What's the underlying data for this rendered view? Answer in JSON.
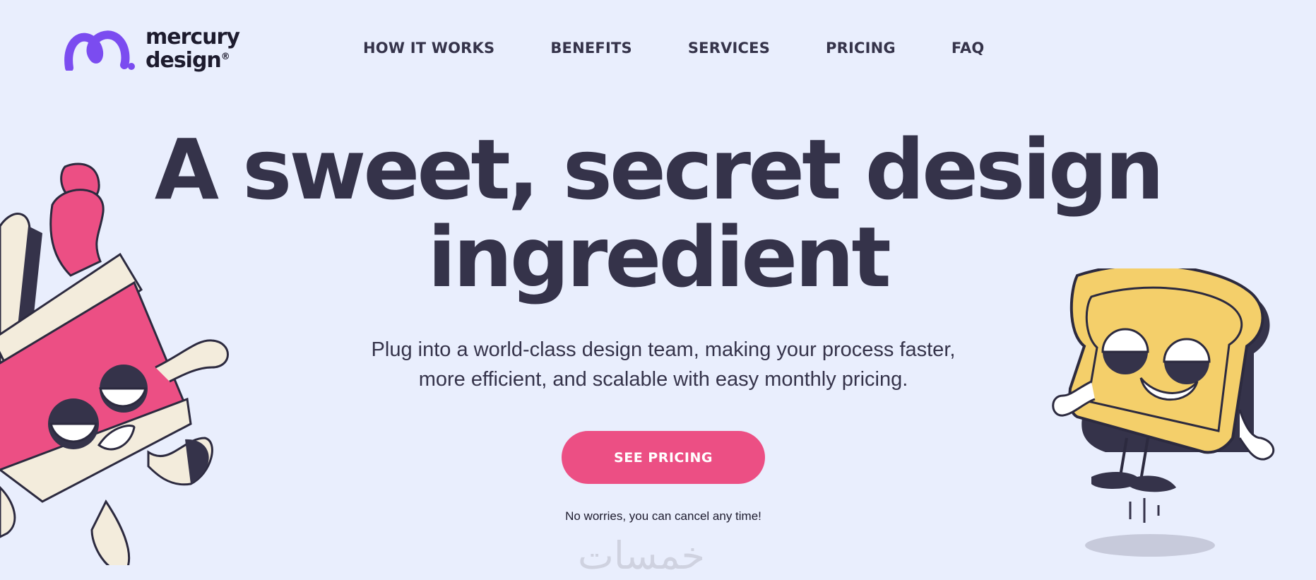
{
  "brand": {
    "line1": "mercury",
    "line2": "design",
    "mark": "®"
  },
  "nav": [
    "HOW IT WORKS",
    "BENEFITS",
    "SERVICES",
    "PRICING",
    "FAQ"
  ],
  "hero": {
    "headline_line1": "A sweet, secret design",
    "headline_line2": "ingredient",
    "sub_line1": "Plug into a world-class design team, making your process faster,",
    "sub_line2": "more efficient, and scalable with easy monthly pricing.",
    "cta": "SEE PRICING",
    "note": "No worries, you can cancel any time!"
  },
  "watermark": "خمسات",
  "colors": {
    "background": "#e9eefd",
    "accent": "#ec4f84",
    "brand": "#7b4cf0",
    "text": "#35334a",
    "toast": "#f4cf6a"
  },
  "icons": [
    "logo-mark-icon",
    "jam-jar-character-icon",
    "toast-character-icon"
  ]
}
